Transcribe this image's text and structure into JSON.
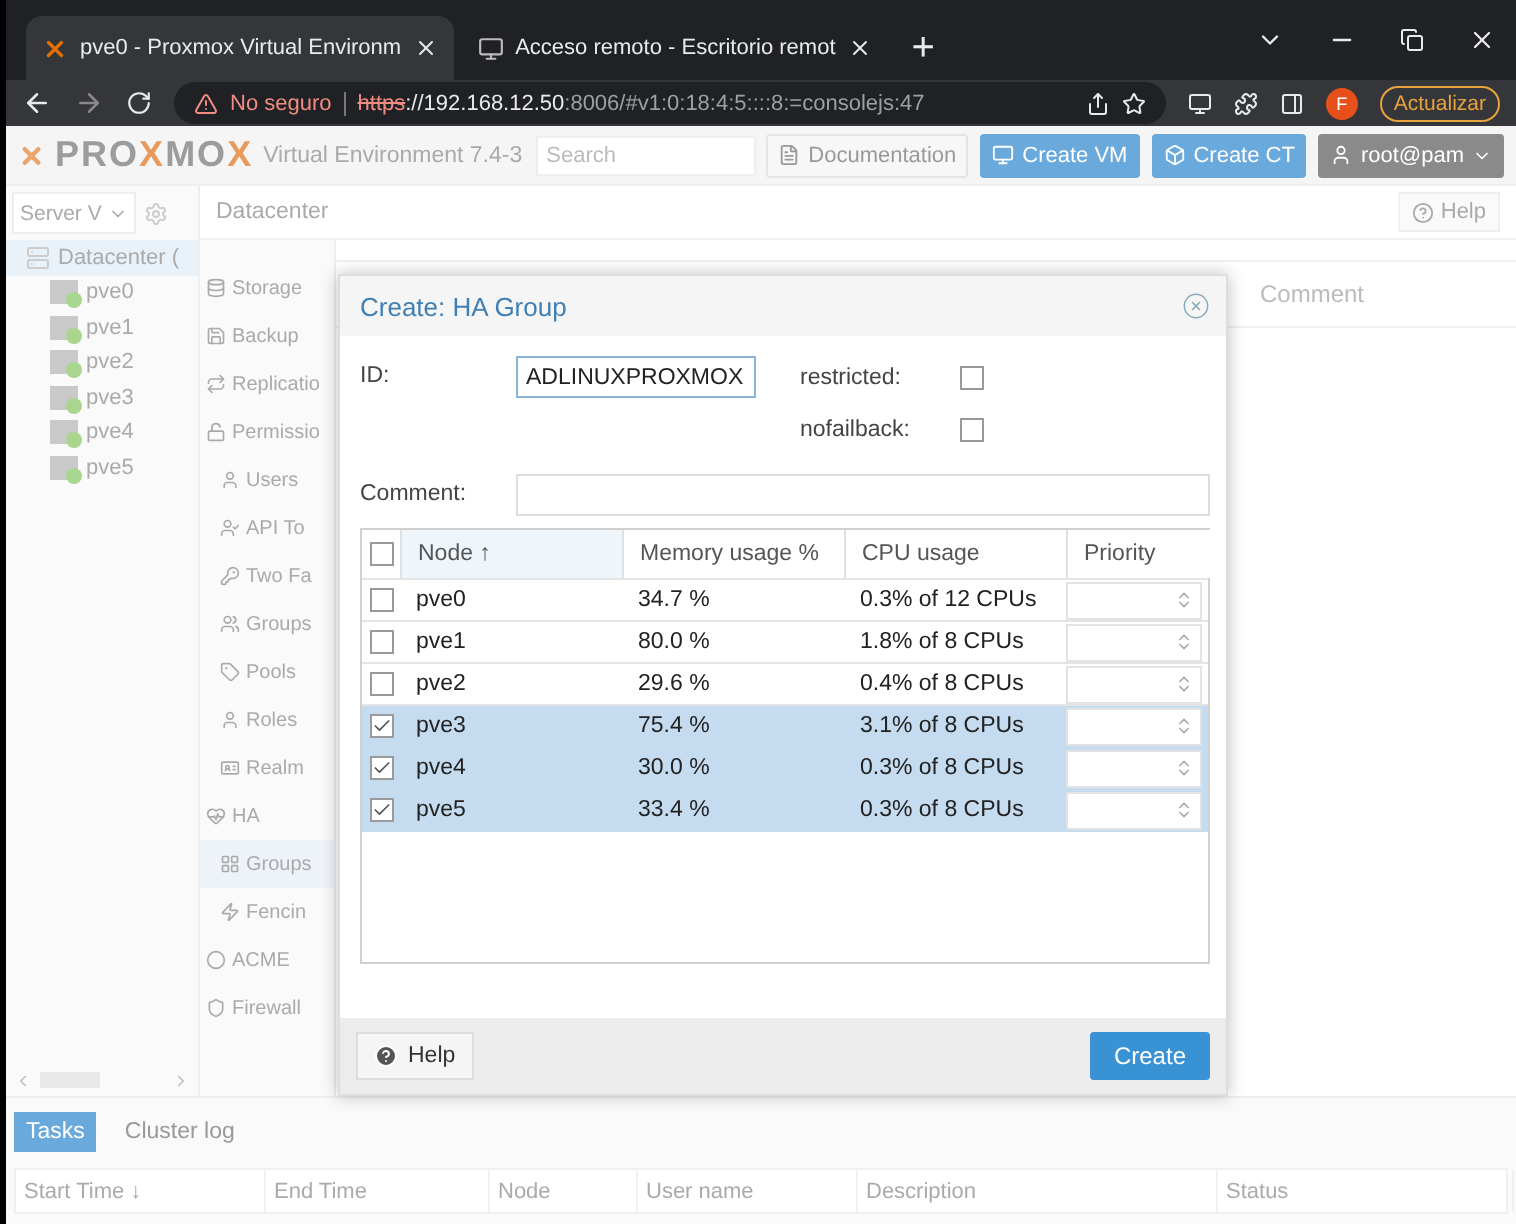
{
  "browser": {
    "tabs": [
      {
        "title": "pve0 - Proxmox Virtual Environm",
        "selected": true,
        "kind": "proxmox"
      },
      {
        "title": "Acceso remoto - Escritorio remot",
        "selected": false,
        "kind": "remote"
      }
    ],
    "new_tab": "+",
    "security": "No seguro",
    "scheme": "https",
    "host": "://192.168.12.50",
    "path": ":8006/#v1:0:18:4:5::::8:=consolejs:47",
    "profile": "F",
    "update": "Actualizar"
  },
  "header": {
    "logo": [
      {
        "text": "PRO",
        "accent": false
      },
      {
        "text": "X",
        "accent": true
      },
      {
        "text": "MO",
        "accent": false
      },
      {
        "text": "X",
        "accent": true
      }
    ],
    "version": "Virtual Environment 7.4-3",
    "search": {
      "placeholder": "Search"
    },
    "buttons": [
      {
        "label": "Documentation",
        "kind": "doc"
      },
      {
        "label": "Create VM",
        "kind": "vm"
      },
      {
        "label": "Create CT",
        "kind": "ct"
      },
      {
        "label": "root@pam",
        "kind": "user"
      }
    ]
  },
  "tree": {
    "view": "Server V",
    "items": [
      {
        "label": "Datacenter (",
        "selected": true,
        "children": [
          {
            "label": "pve0",
            "selected": false
          },
          {
            "label": "pve1",
            "selected": false
          },
          {
            "label": "pve2",
            "selected": false
          },
          {
            "label": "pve3",
            "selected": false
          },
          {
            "label": "pve4",
            "selected": false
          },
          {
            "label": "pve5",
            "selected": false
          }
        ]
      }
    ]
  },
  "content": {
    "title": "Datacenter",
    "help": "Help",
    "background_column": "Comment"
  },
  "nav": [
    {
      "label": "Storage",
      "selected": false
    },
    {
      "label": "Backup",
      "selected": false
    },
    {
      "label": "Replicatio",
      "selected": false
    },
    {
      "label": "Permissio",
      "selected": false,
      "children": [
        {
          "label": "Users",
          "selected": false
        },
        {
          "label": "API To",
          "selected": false
        },
        {
          "label": "Two Fa",
          "selected": false
        },
        {
          "label": "Groups",
          "selected": false
        },
        {
          "label": "Pools",
          "selected": false
        },
        {
          "label": "Roles",
          "selected": false
        },
        {
          "label": "Realm",
          "selected": false
        }
      ]
    },
    {
      "label": "HA",
      "selected": false,
      "children": [
        {
          "label": "Groups",
          "selected": true
        },
        {
          "label": "Fencin",
          "selected": false
        }
      ]
    },
    {
      "label": "ACME",
      "selected": false
    },
    {
      "label": "Firewall",
      "selected": false
    }
  ],
  "dialog": {
    "title": "Create: HA Group",
    "id_label": "ID:",
    "id_value": "ADLINUXPROXMOX",
    "options": [
      {
        "label": "restricted:",
        "checked": false
      },
      {
        "label": "nofailback:",
        "checked": false
      }
    ],
    "comment_label": "Comment:",
    "select_all_checked": false,
    "columns": [
      "Node ↑",
      "Memory usage %",
      "CPU usage",
      "Priority"
    ],
    "rows": [
      {
        "node": "pve0",
        "memory": "34.7 %",
        "cpu": "0.3% of 12 CPUs",
        "selected": false
      },
      {
        "node": "pve1",
        "memory": "80.0 %",
        "cpu": "1.8% of 8 CPUs",
        "selected": false
      },
      {
        "node": "pve2",
        "memory": "29.6 %",
        "cpu": "0.4% of 8 CPUs",
        "selected": false
      },
      {
        "node": "pve3",
        "memory": "75.4 %",
        "cpu": "3.1% of 8 CPUs",
        "selected": true
      },
      {
        "node": "pve4",
        "memory": "30.0 %",
        "cpu": "0.3% of 8 CPUs",
        "selected": true
      },
      {
        "node": "pve5",
        "memory": "33.4 %",
        "cpu": "0.3% of 8 CPUs",
        "selected": true
      }
    ],
    "help": "Help",
    "create": "Create"
  },
  "bottom": {
    "tabs": [
      {
        "label": "Tasks",
        "selected": true
      },
      {
        "label": "Cluster log",
        "selected": false
      }
    ],
    "columns": [
      "Start Time ↓",
      "End Time",
      "Node",
      "User name",
      "Description",
      "Status"
    ]
  }
}
